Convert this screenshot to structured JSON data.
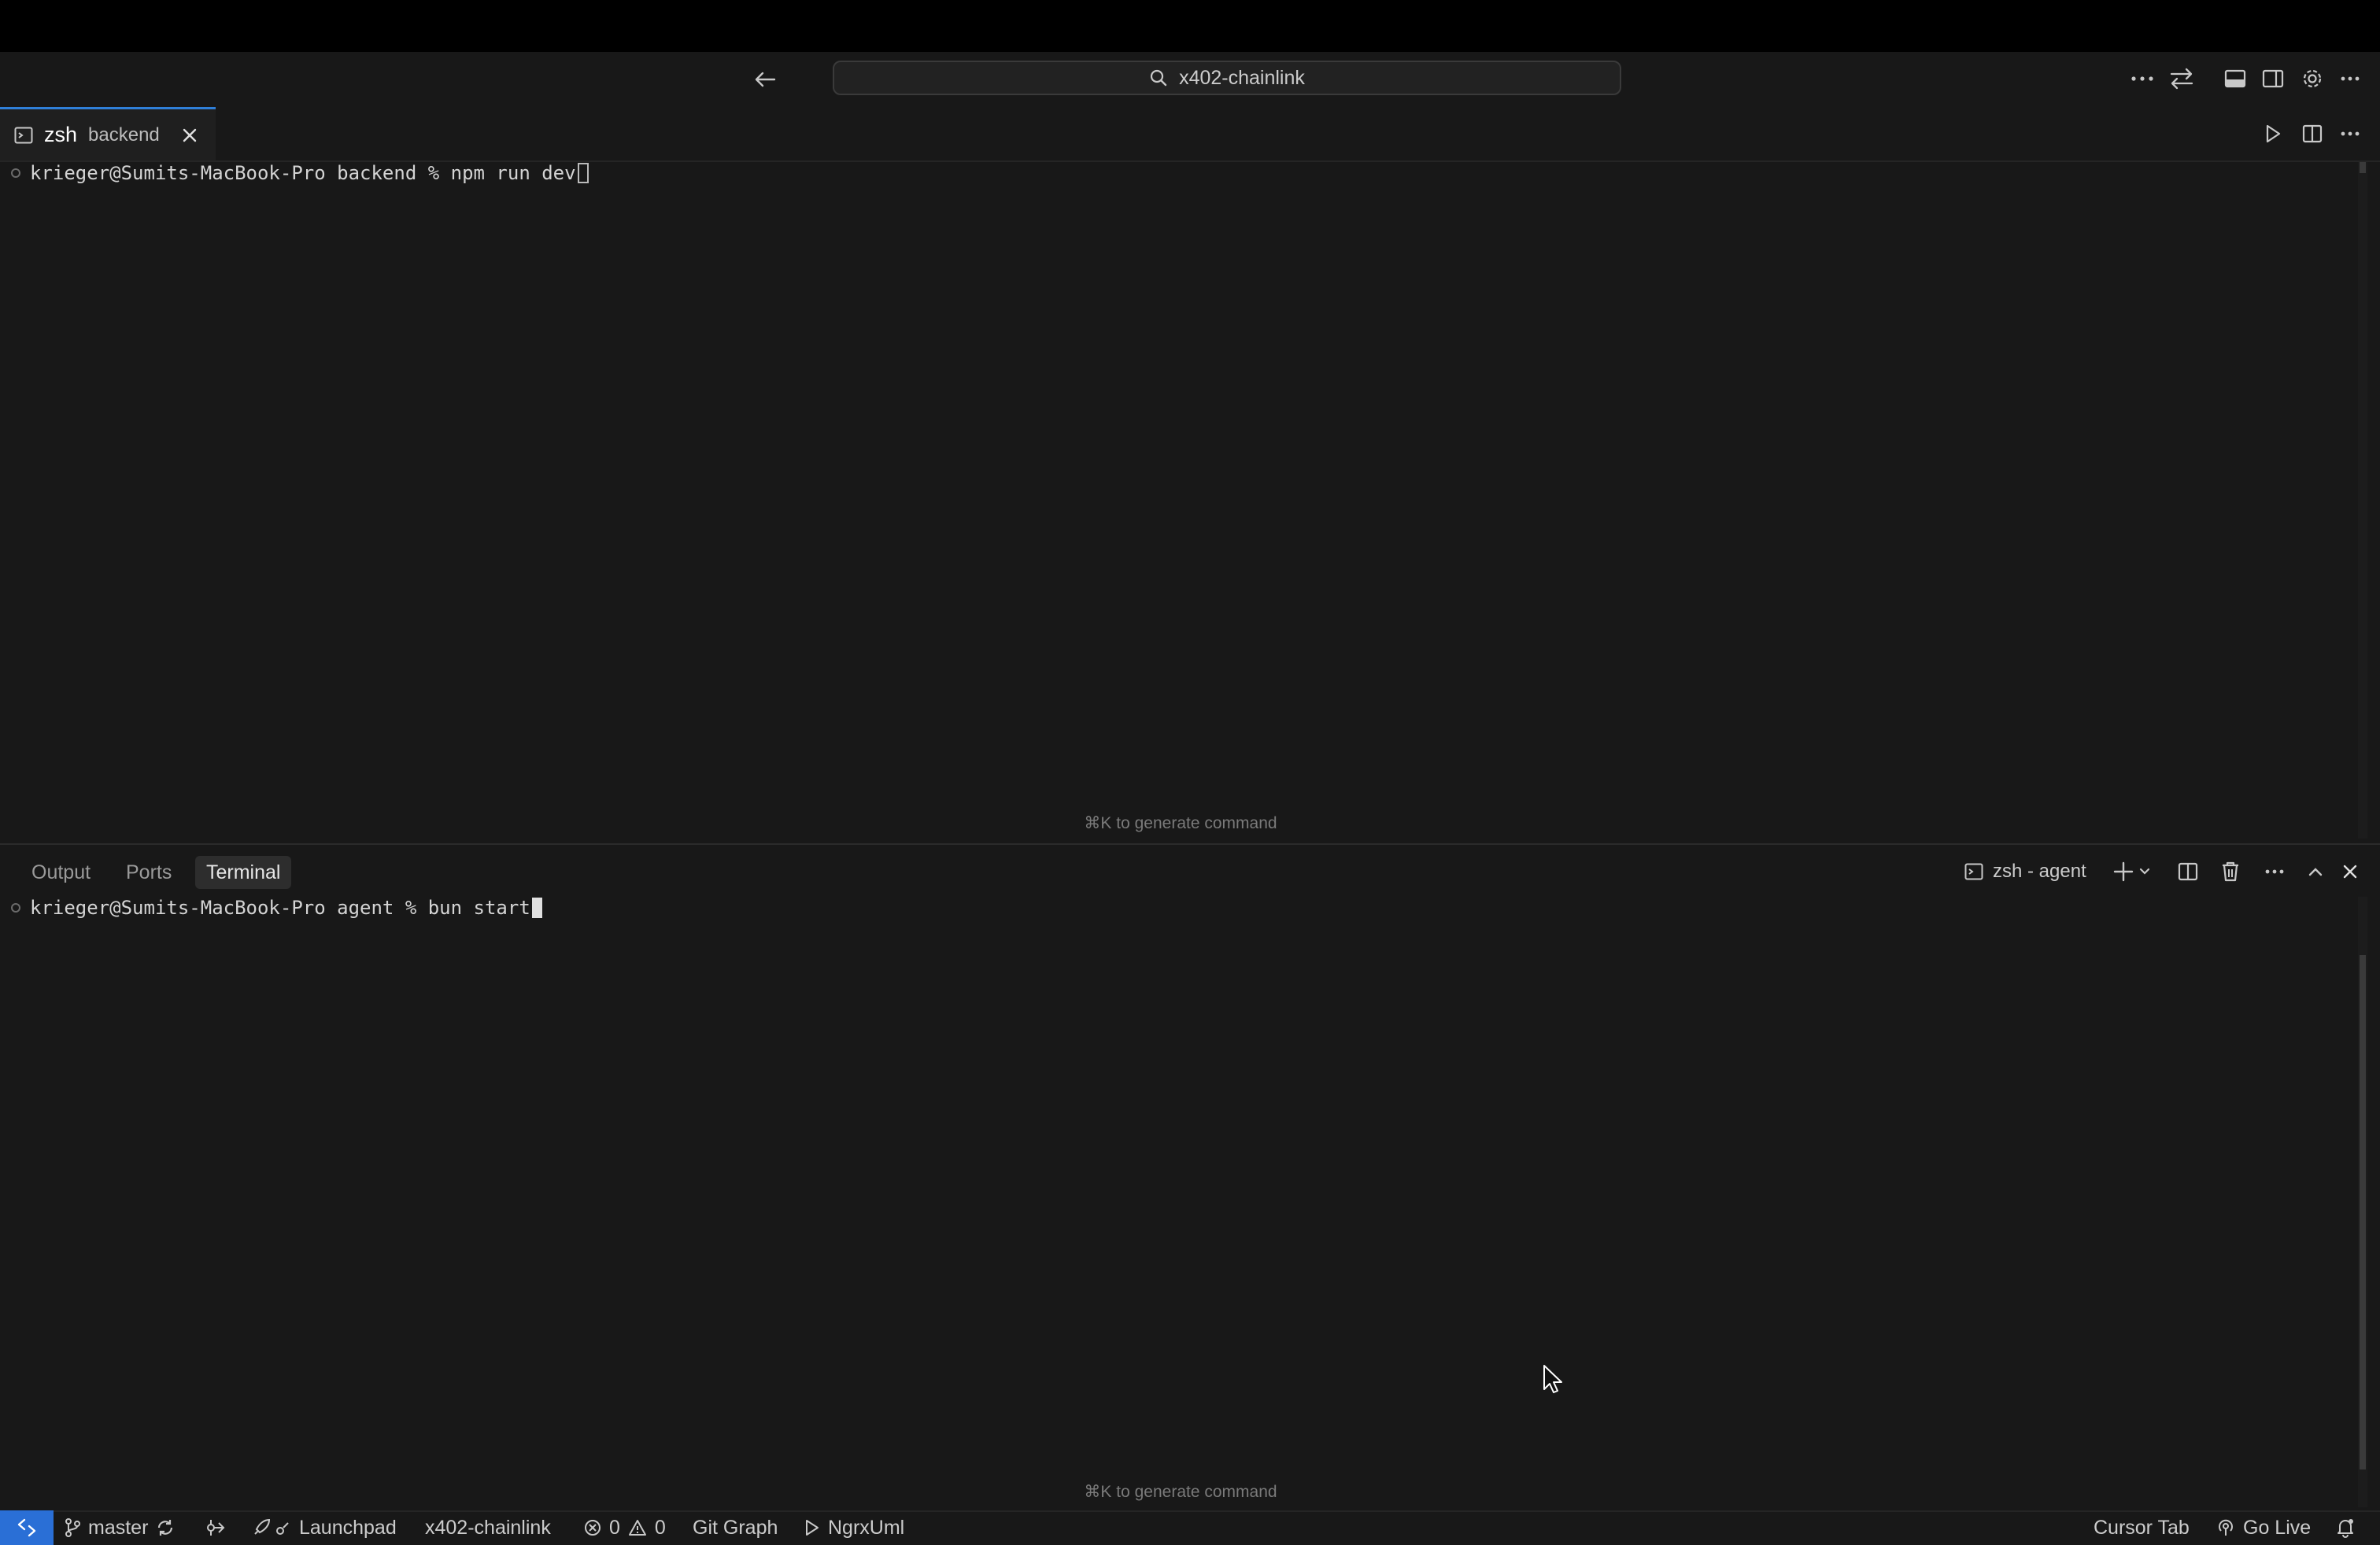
{
  "titlebar": {
    "search_text": "x402-chainlink"
  },
  "editor": {
    "tab": {
      "name": "zsh",
      "description": "backend"
    },
    "terminal_line": "krieger@Sumits-MacBook-Pro backend % npm run dev",
    "hint": "⌘K to generate command"
  },
  "panel": {
    "tabs": [
      {
        "label": "Output"
      },
      {
        "label": "Ports"
      },
      {
        "label": "Terminal"
      }
    ],
    "terminal_selector": "zsh - agent",
    "terminal_line": "krieger@Sumits-MacBook-Pro agent % bun start",
    "hint": "⌘K to generate command"
  },
  "statusbar": {
    "branch": "master",
    "launchpad": "Launchpad",
    "workspace": "x402-chainlink",
    "errors": "0",
    "warnings": "0",
    "git_graph": "Git Graph",
    "ngrx": "NgrxUml",
    "cursor_tab": "Cursor Tab",
    "go_live": "Go Live"
  },
  "colors": {
    "background": "#181818",
    "accent": "#2a6fd6",
    "tab_border": "#2f7fd8"
  }
}
